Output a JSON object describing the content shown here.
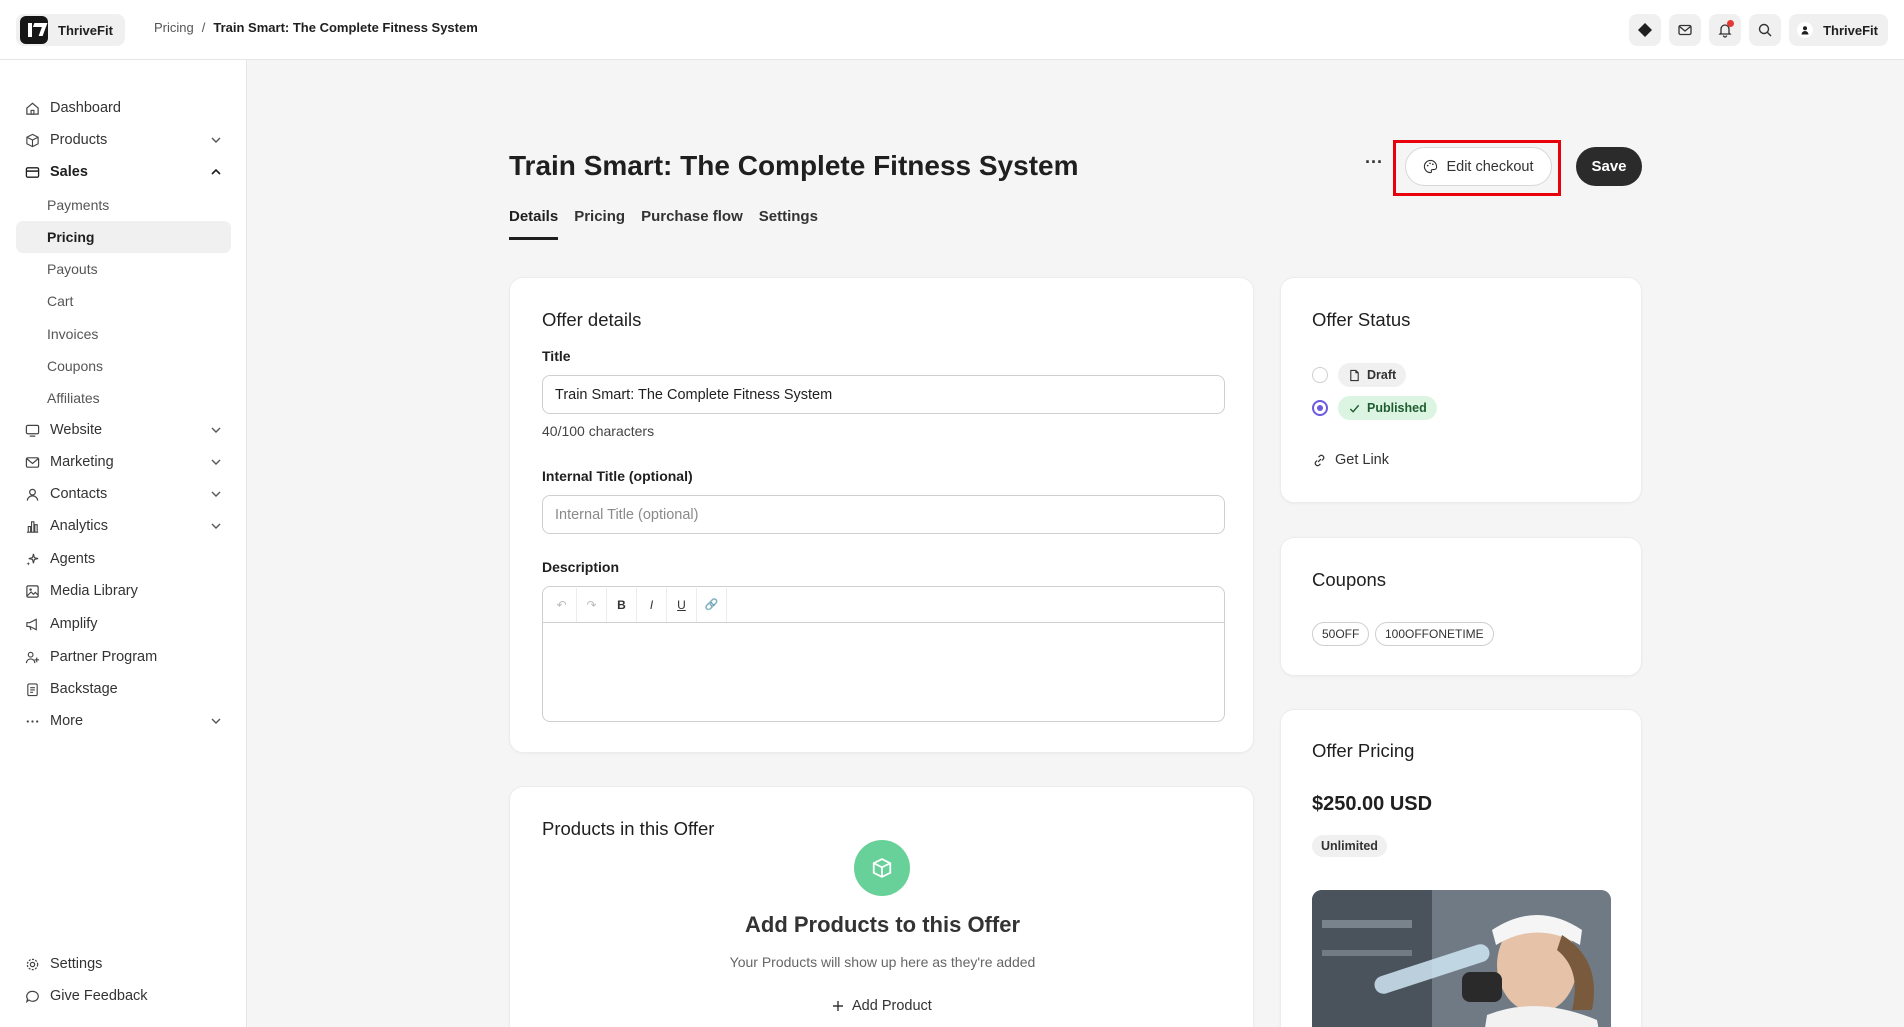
{
  "brand": {
    "name": "ThriveFit"
  },
  "breadcrumb": {
    "parent": "Pricing",
    "separator": "/",
    "current": "Train Smart: The Complete Fitness System"
  },
  "topbar": {
    "user_name": "ThriveFit"
  },
  "sidebar": {
    "items": [
      {
        "label": "Dashboard"
      },
      {
        "label": "Products"
      },
      {
        "label": "Sales"
      },
      {
        "label": "Website"
      },
      {
        "label": "Marketing"
      },
      {
        "label": "Contacts"
      },
      {
        "label": "Analytics"
      },
      {
        "label": "Agents"
      },
      {
        "label": "Media Library"
      },
      {
        "label": "Amplify"
      },
      {
        "label": "Partner Program"
      },
      {
        "label": "Backstage"
      },
      {
        "label": "More"
      }
    ],
    "sales_sub": [
      {
        "label": "Payments"
      },
      {
        "label": "Pricing"
      },
      {
        "label": "Payouts"
      },
      {
        "label": "Cart"
      },
      {
        "label": "Invoices"
      },
      {
        "label": "Coupons"
      },
      {
        "label": "Affiliates"
      }
    ],
    "footer": [
      {
        "label": "Settings"
      },
      {
        "label": "Give Feedback"
      }
    ]
  },
  "page": {
    "title": "Train Smart: The Complete Fitness System",
    "more": "···",
    "edit_checkout": "Edit checkout",
    "save": "Save",
    "tabs": [
      "Details",
      "Pricing",
      "Purchase flow",
      "Settings"
    ]
  },
  "offer_details": {
    "heading": "Offer details",
    "title_label": "Title",
    "title_value": "Train Smart: The Complete Fitness System",
    "char_count": "40/100 characters",
    "internal_label": "Internal Title (optional)",
    "internal_placeholder": "Internal Title (optional)",
    "description_label": "Description",
    "toolbar": [
      "↶",
      "↷",
      "B",
      "I",
      "U",
      "🔗"
    ]
  },
  "products": {
    "heading": "Products in this Offer",
    "empty_title": "Add Products to this Offer",
    "empty_sub": "Your Products will show up here as they're added",
    "add_label": "Add Product"
  },
  "status": {
    "heading": "Offer Status",
    "draft": "Draft",
    "published": "Published",
    "selected": "Published",
    "get_link": "Get Link"
  },
  "coupons": {
    "heading": "Coupons",
    "items": [
      "50OFF",
      "100OFFONETIME"
    ]
  },
  "pricing": {
    "heading": "Offer Pricing",
    "price": "$250.00 USD",
    "badge": "Unlimited"
  },
  "colors": {
    "accent": "#6a5ae0",
    "published_bg": "#dcf5e2",
    "product_icon": "#68d199",
    "highlight": "#e8000b"
  }
}
